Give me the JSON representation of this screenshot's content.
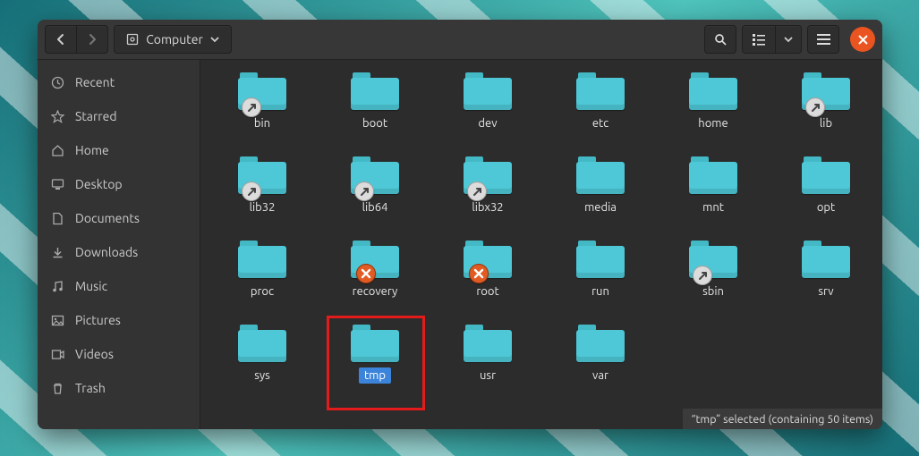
{
  "path_label": "Computer",
  "sidebar": [
    {
      "icon": "clock",
      "label": "Recent"
    },
    {
      "icon": "star",
      "label": "Starred"
    },
    {
      "icon": "home",
      "label": "Home"
    },
    {
      "icon": "desktop",
      "label": "Desktop"
    },
    {
      "icon": "documents",
      "label": "Documents"
    },
    {
      "icon": "downloads",
      "label": "Downloads"
    },
    {
      "icon": "music",
      "label": "Music"
    },
    {
      "icon": "pictures",
      "label": "Pictures"
    },
    {
      "icon": "videos",
      "label": "Videos"
    },
    {
      "icon": "trash",
      "label": "Trash"
    }
  ],
  "folders": [
    {
      "name": "bin",
      "emblem": "link"
    },
    {
      "name": "boot"
    },
    {
      "name": "dev"
    },
    {
      "name": "etc"
    },
    {
      "name": "home"
    },
    {
      "name": "lib",
      "emblem": "link"
    },
    {
      "name": "lib32",
      "emblem": "link"
    },
    {
      "name": "lib64",
      "emblem": "link"
    },
    {
      "name": "libx32",
      "emblem": "link"
    },
    {
      "name": "media"
    },
    {
      "name": "mnt"
    },
    {
      "name": "opt"
    },
    {
      "name": "proc"
    },
    {
      "name": "recovery",
      "emblem": "deny"
    },
    {
      "name": "root",
      "emblem": "deny"
    },
    {
      "name": "run"
    },
    {
      "name": "sbin",
      "emblem": "link"
    },
    {
      "name": "srv"
    },
    {
      "name": "sys"
    },
    {
      "name": "tmp",
      "selected": true,
      "highlighted": true
    },
    {
      "name": "usr"
    },
    {
      "name": "var"
    }
  ],
  "status_text": "“tmp” selected  (containing 50 items)"
}
